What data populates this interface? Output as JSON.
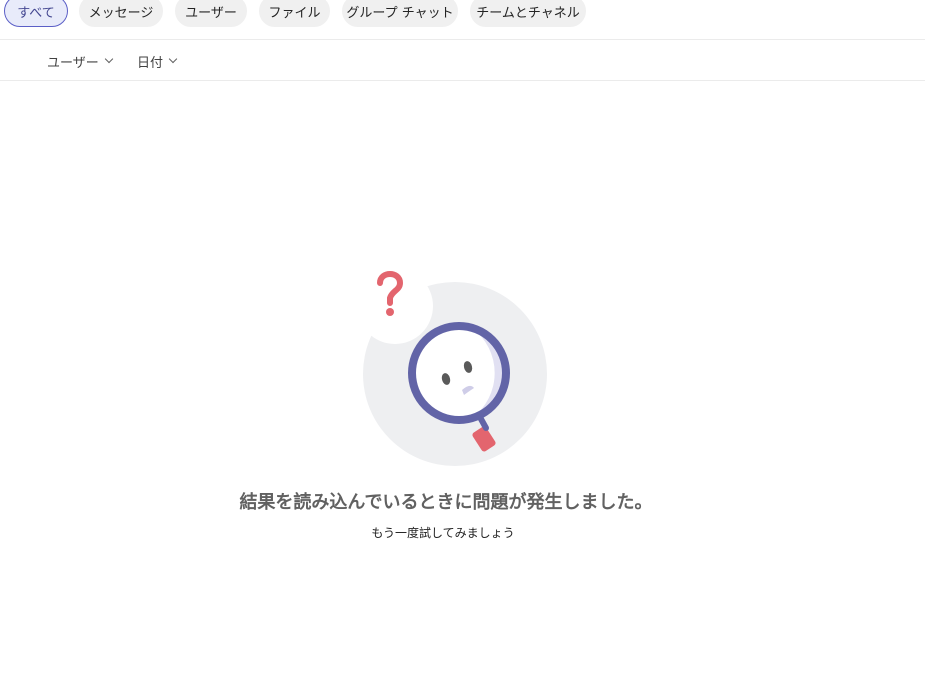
{
  "tabs": [
    {
      "label": "すべて",
      "active": true
    },
    {
      "label": "メッセージ",
      "active": false
    },
    {
      "label": "ユーザー",
      "active": false
    },
    {
      "label": "ファイル",
      "active": false
    },
    {
      "label": "グループ チャット",
      "active": false
    },
    {
      "label": "チームとチャネル",
      "active": false
    }
  ],
  "filters": {
    "user_label": "ユーザー",
    "date_label": "日付"
  },
  "error": {
    "title": "結果を読み込んでいるときに問題が発生しました。",
    "subtitle": "もう一度試してみましょう",
    "icons": [
      "question-mark-icon",
      "magnifier-icon"
    ]
  },
  "colors": {
    "accent": "#5b5fc7",
    "accent_bg": "#e8ebfa",
    "pill_bg": "#f0f0f0",
    "magnifier_ring": "#6264a7",
    "handle_red": "#e3656e",
    "circle_bg": "#eeeff1"
  }
}
